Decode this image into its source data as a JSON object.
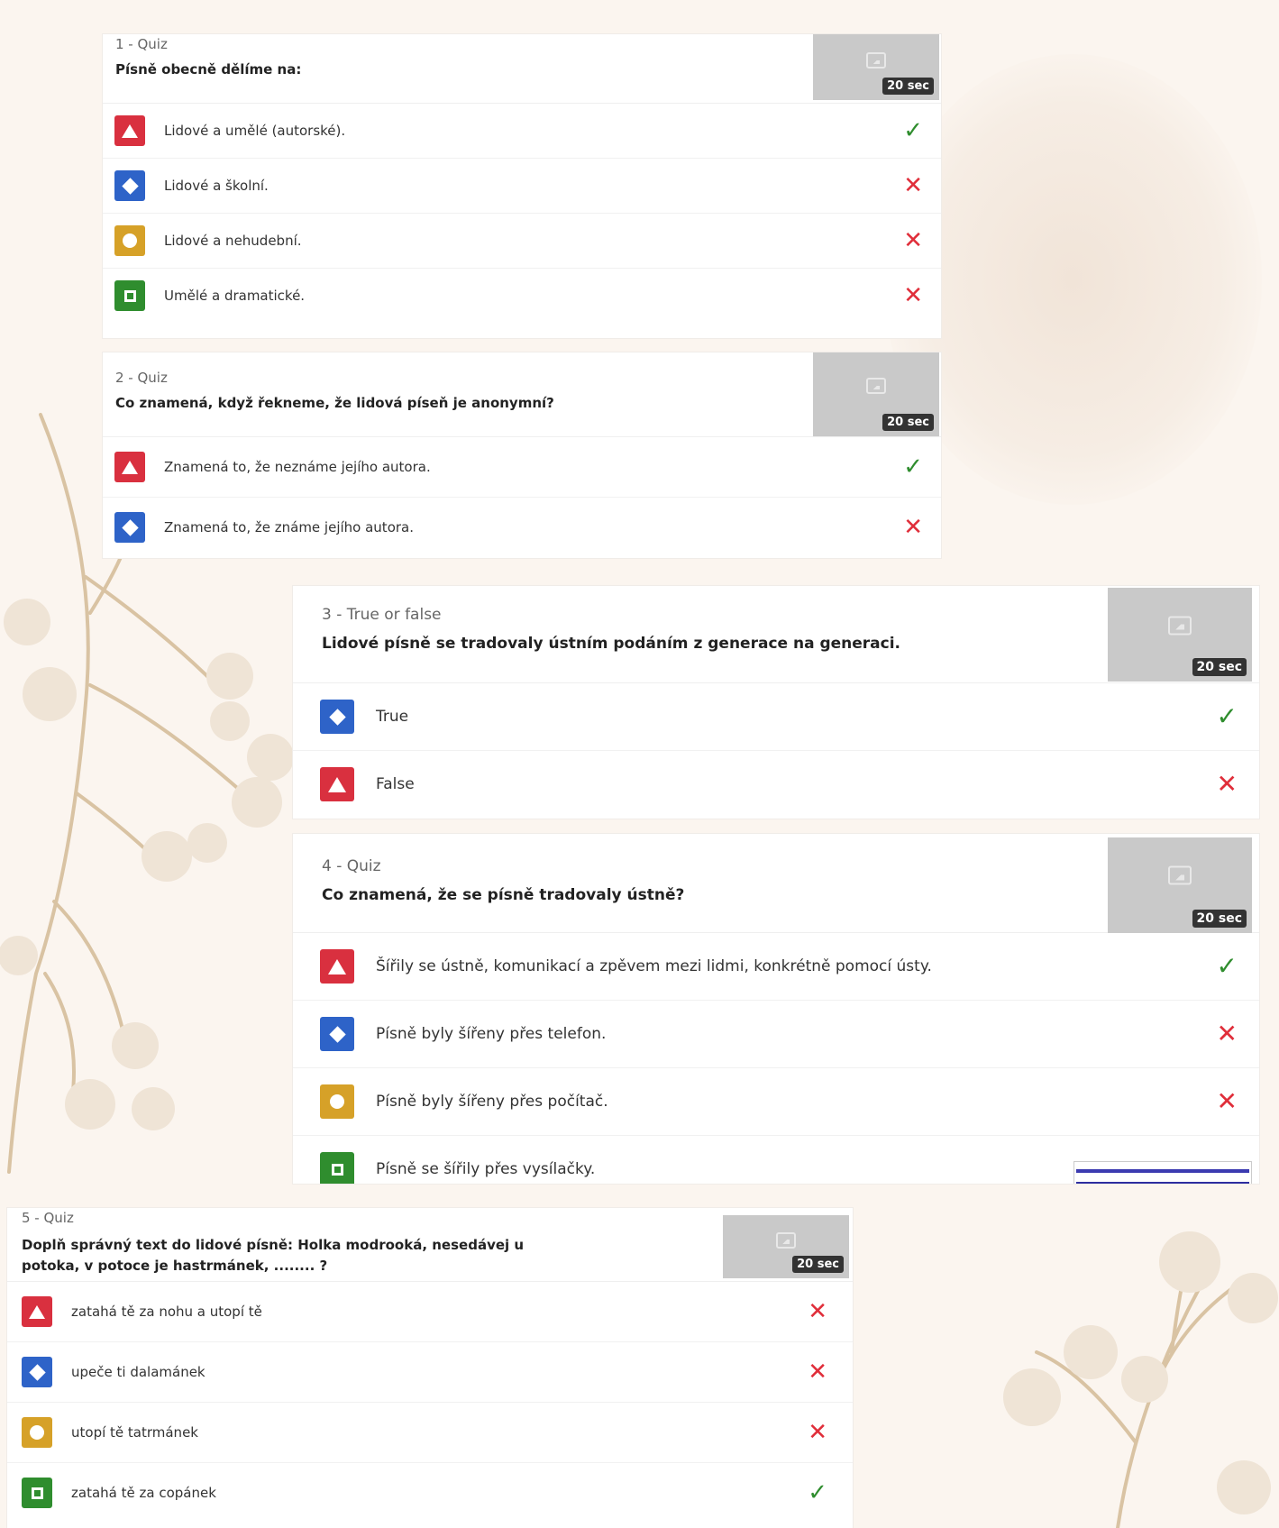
{
  "questions": [
    {
      "type": "1 - Quiz",
      "text": "Písně obecně dělíme na:",
      "time": "20 sec",
      "answers": [
        {
          "text": "Lidové a umělé (autorské).",
          "shape": "triangle",
          "color": "#d9303f",
          "correct": true
        },
        {
          "text": "Lidové a školní.",
          "shape": "diamond",
          "color": "#2e63c8",
          "correct": false
        },
        {
          "text": "Lidové a nehudební.",
          "shape": "circle",
          "color": "#d6a128",
          "correct": false
        },
        {
          "text": "Umělé a dramatické.",
          "shape": "square",
          "color": "#2f8d2e",
          "correct": false
        }
      ]
    },
    {
      "type": "2 - Quiz",
      "text": "Co znamená, když řekneme, že lidová píseň je anonymní?",
      "time": "20 sec",
      "answers": [
        {
          "text": "Znamená to, že neznáme jejího autora.",
          "shape": "triangle",
          "color": "#d9303f",
          "correct": true
        },
        {
          "text": "Znamená to, že známe jejího autora.",
          "shape": "diamond",
          "color": "#2e63c8",
          "correct": false
        }
      ]
    },
    {
      "type": "3 - True or false",
      "text": "Lidové písně se tradovaly ústním podáním z generace na generaci.",
      "time": "20 sec",
      "answers": [
        {
          "text": "True",
          "shape": "diamond",
          "color": "#2e63c8",
          "correct": true
        },
        {
          "text": "False",
          "shape": "triangle",
          "color": "#d9303f",
          "correct": false
        }
      ]
    },
    {
      "type": "4 - Quiz",
      "text": "Co znamená, že se písně tradovaly ústně?",
      "time": "20 sec",
      "answers": [
        {
          "text": "Šířily se ústně, komunikací a zpěvem mezi lidmi, konkrétně pomocí ústy.",
          "shape": "triangle",
          "color": "#d9303f",
          "correct": true
        },
        {
          "text": "Písně byly šířeny přes telefon.",
          "shape": "diamond",
          "color": "#2e63c8",
          "correct": false
        },
        {
          "text": "Písně byly šířeny přes počítač.",
          "shape": "circle",
          "color": "#d6a128",
          "correct": false
        },
        {
          "text": "Písně se šířily přes vysílačky.",
          "shape": "square",
          "color": "#2f8d2e",
          "correct": null
        }
      ]
    },
    {
      "type": "5 - Quiz",
      "text": "Doplň správný text do lidové písně: Holka modrooká, nesedávej u potoka, v potoce je hastrmánek, ........ ?",
      "time": "20 sec",
      "answers": [
        {
          "text": "zatahá tě za nohu a utopí tě",
          "shape": "triangle",
          "color": "#d9303f",
          "correct": false
        },
        {
          "text": "upeče ti dalamánek",
          "shape": "diamond",
          "color": "#2e63c8",
          "correct": false
        },
        {
          "text": "utopí tě tatrmánek",
          "shape": "circle",
          "color": "#d6a128",
          "correct": false
        },
        {
          "text": "zatahá tě za copánek",
          "shape": "square",
          "color": "#2f8d2e",
          "correct": true
        }
      ]
    }
  ]
}
